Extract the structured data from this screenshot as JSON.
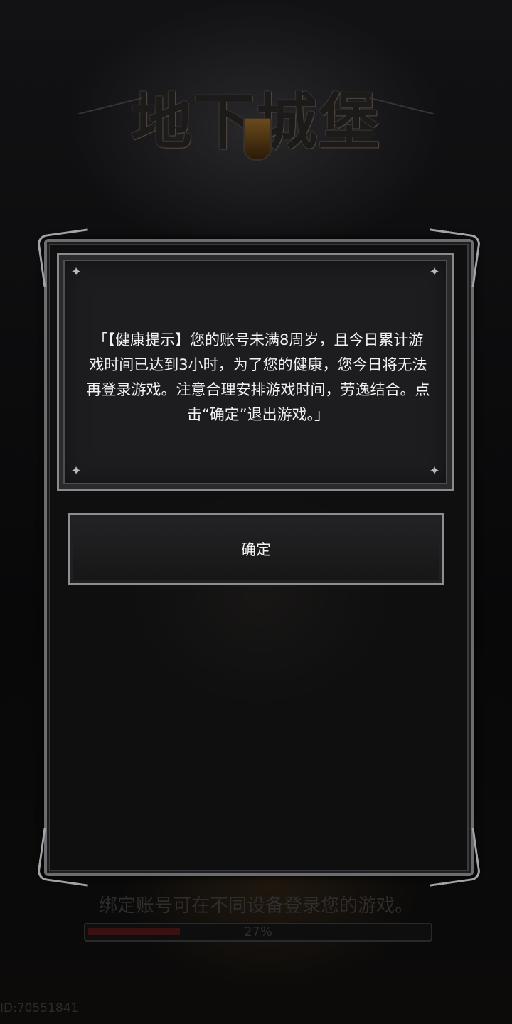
{
  "game": {
    "logo_title": "地下城堡"
  },
  "dialog": {
    "message": "「【健康提示】您的账号未满8周岁，且今日累计游戏时间已达到3小时，为了您的健康，您今日将无法再登录游戏。注意合理安排游戏时间，劳逸结合。点击“确定”退出游戏。」",
    "confirm_label": "确定"
  },
  "loading": {
    "tip": "绑定账号可在不同设备登录您的游戏。",
    "progress_label": "27%",
    "progress_value": 0.27
  },
  "footer": {
    "id_label": "ID:70551841"
  },
  "colors": {
    "progress_fill": "#3a1010",
    "frame": "#8a8a8e"
  }
}
